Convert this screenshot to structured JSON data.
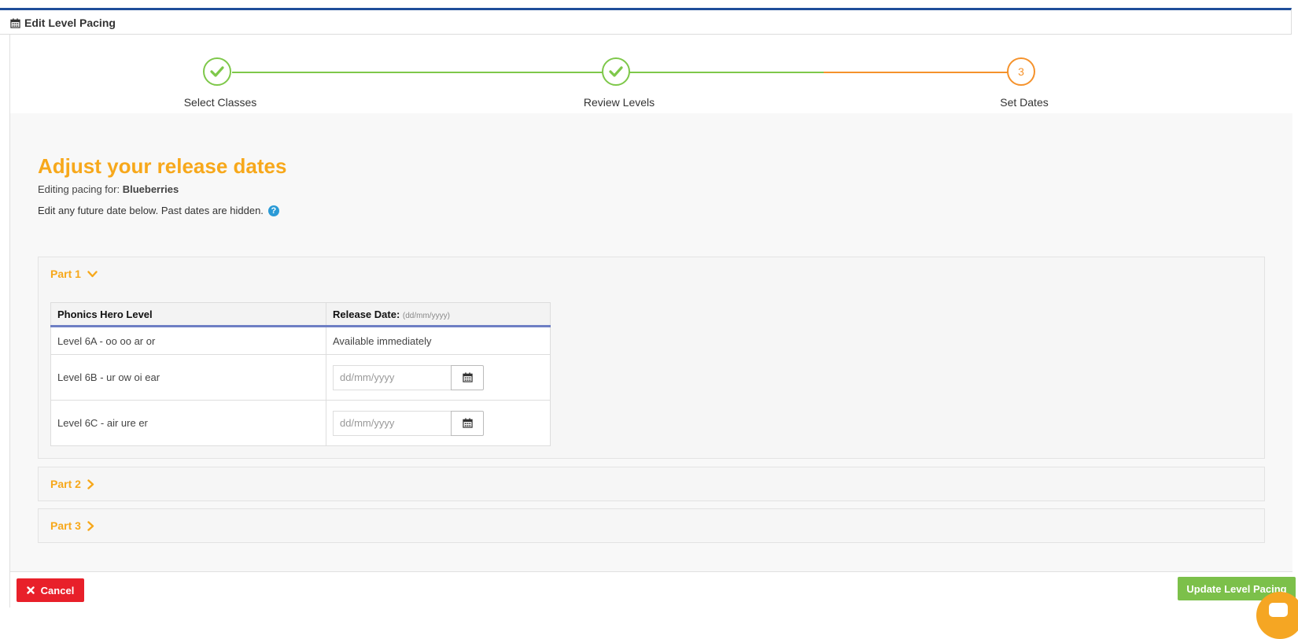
{
  "header": {
    "title": "Edit Level Pacing",
    "icon": "calendar-icon"
  },
  "stepper": {
    "steps": [
      {
        "label": "Select Classes",
        "state": "done"
      },
      {
        "label": "Review Levels",
        "state": "done"
      },
      {
        "label": "Set Dates",
        "state": "active",
        "number": "3"
      }
    ],
    "colors": {
      "done": "#7ec84a",
      "active": "#f5922b"
    }
  },
  "main": {
    "heading": "Adjust your release dates",
    "editing_prefix": "Editing pacing for:",
    "class_name": "Blueberries",
    "hint": "Edit any future date below. Past dates are hidden.",
    "help_glyph": "?"
  },
  "parts": [
    {
      "label": "Part 1",
      "expanded": true,
      "table": {
        "col_level": "Phonics Hero Level",
        "col_date": "Release Date:",
        "col_date_format": "(dd/mm/yyyy)",
        "rows": [
          {
            "level": "Level 6A - oo oo ar or",
            "release": "Available immediately"
          },
          {
            "level": "Level 6B - ur ow oi ear",
            "placeholder": "dd/mm/yyyy"
          },
          {
            "level": "Level 6C - air ure er",
            "placeholder": "dd/mm/yyyy"
          }
        ]
      }
    },
    {
      "label": "Part 2",
      "expanded": false
    },
    {
      "label": "Part 3",
      "expanded": false
    }
  ],
  "footer": {
    "cancel_label": "Cancel",
    "update_label": "Update Level Pacing"
  },
  "colors": {
    "accent": "#f7a81b",
    "cancel": "#e8202a",
    "update": "#7cc04a",
    "header_border": "#1f4e9a"
  }
}
